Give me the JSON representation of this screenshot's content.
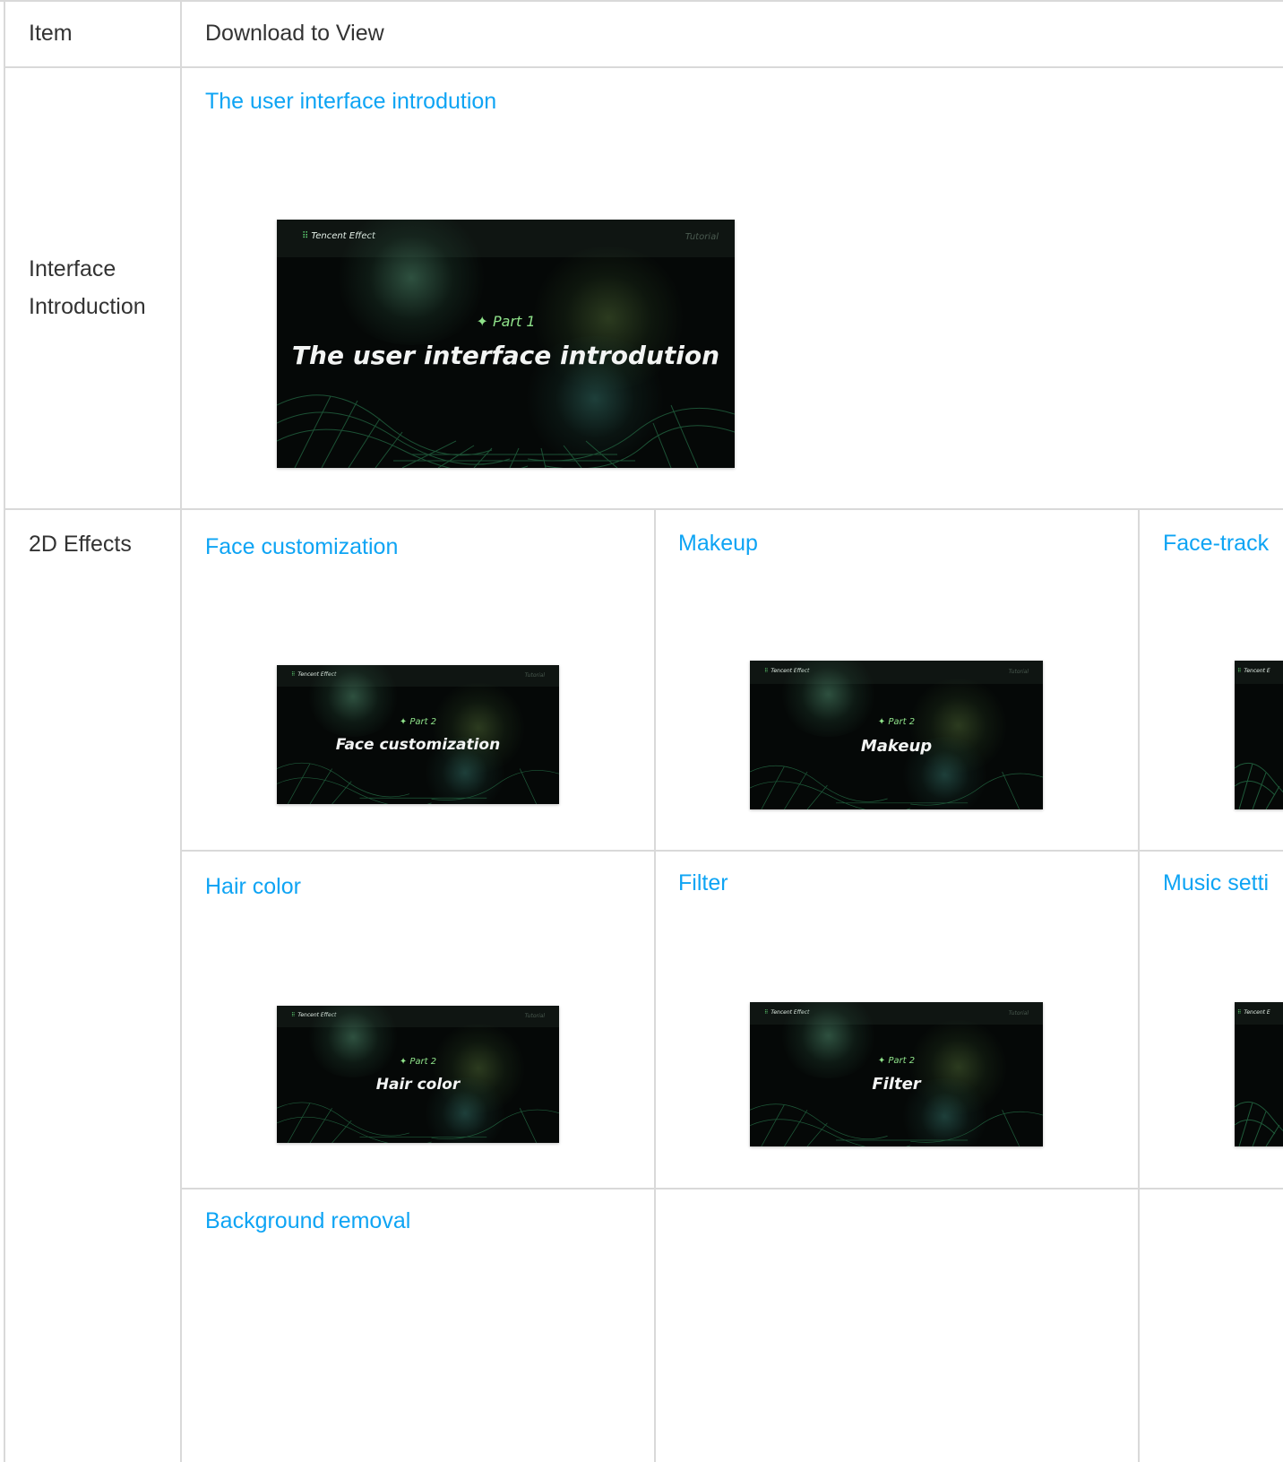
{
  "header": {
    "col_item": "Item",
    "col_download": "Download to View"
  },
  "rows": {
    "interface": {
      "label_line1": "Interface",
      "label_line2": "Introduction",
      "link": "The user interface introdution",
      "thumb": {
        "brand": "Tencent Effect",
        "tag": "Tutorial",
        "part": "✦ Part 1",
        "title": "The user interface introdution"
      }
    },
    "effects2d": {
      "label": "2D Effects",
      "cells": [
        {
          "link": "Face customization",
          "thumb": {
            "brand": "Tencent Effect",
            "tag": "Tutorial",
            "part": "✦ Part 2",
            "title": "Face  customization"
          }
        },
        {
          "link": "Makeup",
          "thumb": {
            "brand": "Tencent Effect",
            "tag": "Tutorial",
            "part": "✦ Part 2",
            "title": "Makeup"
          }
        },
        {
          "link": "Face-track",
          "thumb": {
            "brand": "Tencent E"
          }
        },
        {
          "link": "Hair color",
          "thumb": {
            "brand": "Tencent Effect",
            "tag": "Tutorial",
            "part": "✦ Part 2",
            "title": "Hair color"
          }
        },
        {
          "link": "Filter",
          "thumb": {
            "brand": "Tencent Effect",
            "tag": "Tutorial",
            "part": "✦ Part 2",
            "title": "Filter"
          }
        },
        {
          "link": "Music setti",
          "thumb": {
            "brand": "Tencent E"
          }
        },
        {
          "link": "Background removal"
        }
      ]
    }
  },
  "colors": {
    "link": "#0ea4f4",
    "border": "#d9d9d9",
    "thumb_bg": "#050807",
    "accent_green": "#8fe38a"
  }
}
